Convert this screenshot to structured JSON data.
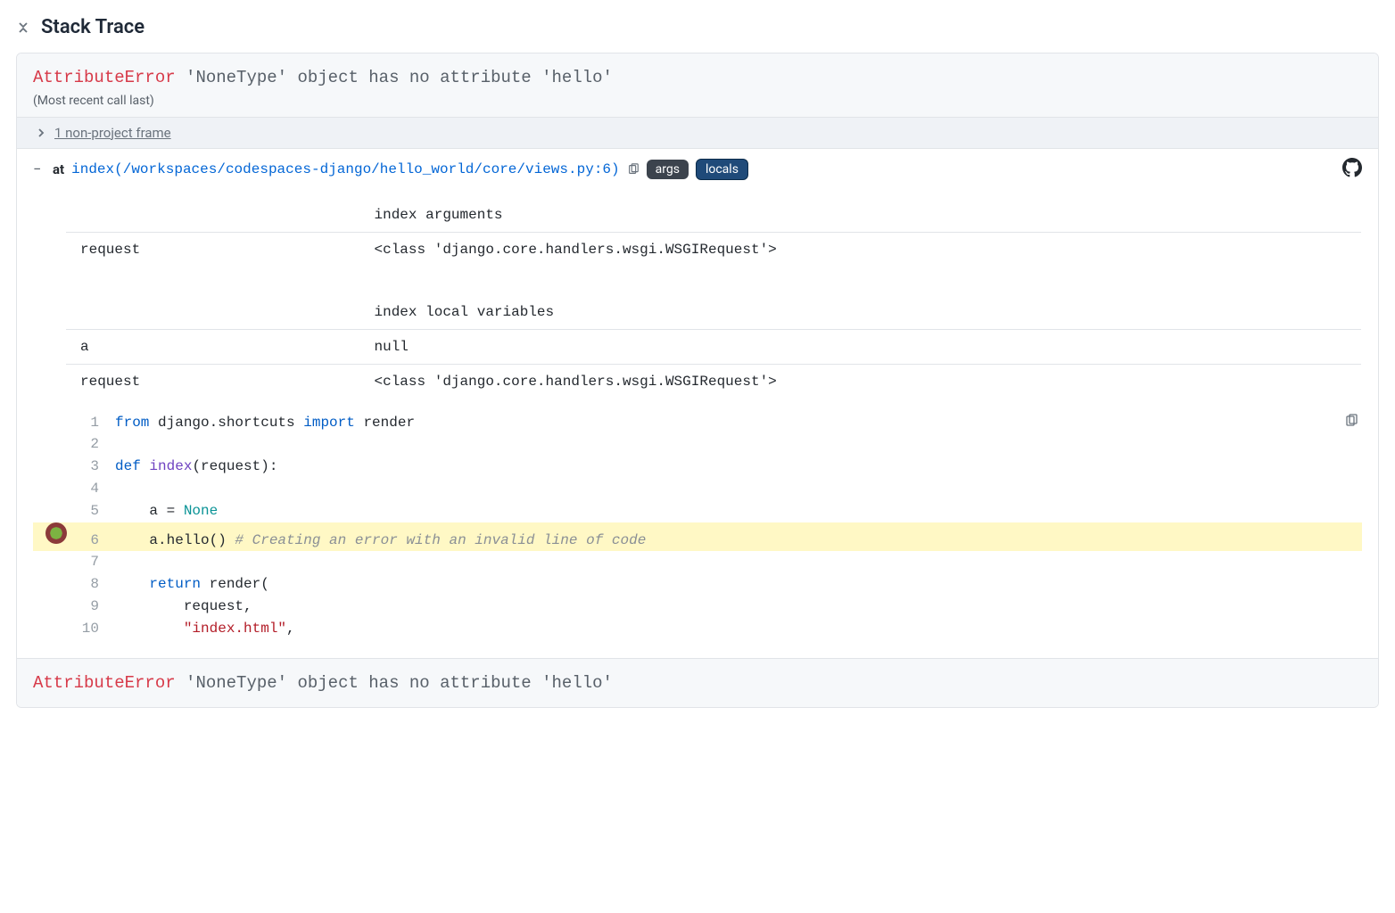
{
  "title": "Stack Trace",
  "error": {
    "cls": "AttributeError",
    "msg": "'NoneType' object has no attribute 'hello'",
    "note": "(Most recent call last)"
  },
  "collapsed": {
    "label": "1 non-project frame"
  },
  "frame": {
    "at": "at",
    "fn": "index",
    "path": "(/workspaces/codespaces-django/hello_world/core/views.py:6)",
    "args_pill": "args",
    "locals_pill": "locals"
  },
  "args_table": {
    "header": "index arguments",
    "rows": [
      {
        "k": "request",
        "v": "<class 'django.core.handlers.wsgi.WSGIRequest'>"
      }
    ]
  },
  "locals_table": {
    "header": "index local variables",
    "rows": [
      {
        "k": "a",
        "v": "null"
      },
      {
        "k": "request",
        "v": "<class 'django.core.handlers.wsgi.WSGIRequest'>"
      }
    ]
  },
  "code": {
    "highlight_line": 6,
    "lines": [
      {
        "n": 1,
        "tokens": [
          [
            "kw",
            "from"
          ],
          [
            "",
            " django.shortcuts "
          ],
          [
            "kw",
            "import"
          ],
          [
            "",
            " render"
          ]
        ]
      },
      {
        "n": 2,
        "tokens": []
      },
      {
        "n": 3,
        "tokens": [
          [
            "kw",
            "def"
          ],
          [
            "",
            " "
          ],
          [
            "fn",
            "index"
          ],
          [
            "",
            "(request):"
          ]
        ]
      },
      {
        "n": 4,
        "tokens": []
      },
      {
        "n": 5,
        "tokens": [
          [
            "",
            "    a = "
          ],
          [
            "builtin",
            "None"
          ]
        ]
      },
      {
        "n": 6,
        "tokens": [
          [
            "",
            "    a.hello() "
          ],
          [
            "cmt",
            "# Creating an error with an invalid line of code"
          ]
        ]
      },
      {
        "n": 7,
        "tokens": []
      },
      {
        "n": 8,
        "tokens": [
          [
            "",
            "    "
          ],
          [
            "kw",
            "return"
          ],
          [
            "",
            " render("
          ]
        ]
      },
      {
        "n": 9,
        "tokens": [
          [
            "",
            "        request,"
          ]
        ]
      },
      {
        "n": 10,
        "tokens": [
          [
            "",
            "        "
          ],
          [
            "str",
            "\"index.html\""
          ],
          [
            "",
            ","
          ]
        ]
      }
    ]
  },
  "footer": {
    "cls": "AttributeError",
    "msg": "'NoneType' object has no attribute 'hello'"
  }
}
